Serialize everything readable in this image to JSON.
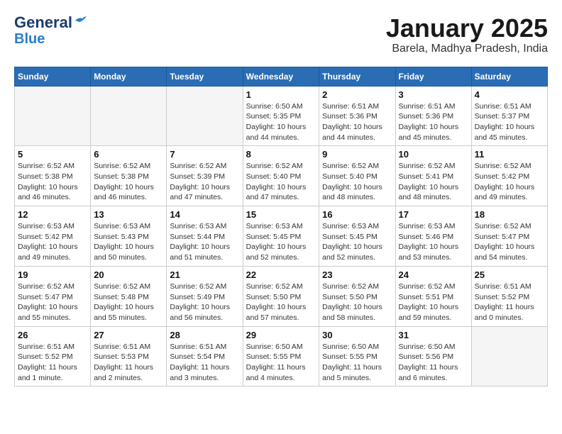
{
  "header": {
    "logo_general": "General",
    "logo_blue": "Blue",
    "month_title": "January 2025",
    "location": "Barela, Madhya Pradesh, India"
  },
  "days_of_week": [
    "Sunday",
    "Monday",
    "Tuesday",
    "Wednesday",
    "Thursday",
    "Friday",
    "Saturday"
  ],
  "weeks": [
    [
      {
        "day": "",
        "info": ""
      },
      {
        "day": "",
        "info": ""
      },
      {
        "day": "",
        "info": ""
      },
      {
        "day": "1",
        "info": "Sunrise: 6:50 AM\nSunset: 5:35 PM\nDaylight: 10 hours\nand 44 minutes."
      },
      {
        "day": "2",
        "info": "Sunrise: 6:51 AM\nSunset: 5:36 PM\nDaylight: 10 hours\nand 44 minutes."
      },
      {
        "day": "3",
        "info": "Sunrise: 6:51 AM\nSunset: 5:36 PM\nDaylight: 10 hours\nand 45 minutes."
      },
      {
        "day": "4",
        "info": "Sunrise: 6:51 AM\nSunset: 5:37 PM\nDaylight: 10 hours\nand 45 minutes."
      }
    ],
    [
      {
        "day": "5",
        "info": "Sunrise: 6:52 AM\nSunset: 5:38 PM\nDaylight: 10 hours\nand 46 minutes."
      },
      {
        "day": "6",
        "info": "Sunrise: 6:52 AM\nSunset: 5:38 PM\nDaylight: 10 hours\nand 46 minutes."
      },
      {
        "day": "7",
        "info": "Sunrise: 6:52 AM\nSunset: 5:39 PM\nDaylight: 10 hours\nand 47 minutes."
      },
      {
        "day": "8",
        "info": "Sunrise: 6:52 AM\nSunset: 5:40 PM\nDaylight: 10 hours\nand 47 minutes."
      },
      {
        "day": "9",
        "info": "Sunrise: 6:52 AM\nSunset: 5:40 PM\nDaylight: 10 hours\nand 48 minutes."
      },
      {
        "day": "10",
        "info": "Sunrise: 6:52 AM\nSunset: 5:41 PM\nDaylight: 10 hours\nand 48 minutes."
      },
      {
        "day": "11",
        "info": "Sunrise: 6:52 AM\nSunset: 5:42 PM\nDaylight: 10 hours\nand 49 minutes."
      }
    ],
    [
      {
        "day": "12",
        "info": "Sunrise: 6:53 AM\nSunset: 5:42 PM\nDaylight: 10 hours\nand 49 minutes."
      },
      {
        "day": "13",
        "info": "Sunrise: 6:53 AM\nSunset: 5:43 PM\nDaylight: 10 hours\nand 50 minutes."
      },
      {
        "day": "14",
        "info": "Sunrise: 6:53 AM\nSunset: 5:44 PM\nDaylight: 10 hours\nand 51 minutes."
      },
      {
        "day": "15",
        "info": "Sunrise: 6:53 AM\nSunset: 5:45 PM\nDaylight: 10 hours\nand 52 minutes."
      },
      {
        "day": "16",
        "info": "Sunrise: 6:53 AM\nSunset: 5:45 PM\nDaylight: 10 hours\nand 52 minutes."
      },
      {
        "day": "17",
        "info": "Sunrise: 6:53 AM\nSunset: 5:46 PM\nDaylight: 10 hours\nand 53 minutes."
      },
      {
        "day": "18",
        "info": "Sunrise: 6:52 AM\nSunset: 5:47 PM\nDaylight: 10 hours\nand 54 minutes."
      }
    ],
    [
      {
        "day": "19",
        "info": "Sunrise: 6:52 AM\nSunset: 5:47 PM\nDaylight: 10 hours\nand 55 minutes."
      },
      {
        "day": "20",
        "info": "Sunrise: 6:52 AM\nSunset: 5:48 PM\nDaylight: 10 hours\nand 55 minutes."
      },
      {
        "day": "21",
        "info": "Sunrise: 6:52 AM\nSunset: 5:49 PM\nDaylight: 10 hours\nand 56 minutes."
      },
      {
        "day": "22",
        "info": "Sunrise: 6:52 AM\nSunset: 5:50 PM\nDaylight: 10 hours\nand 57 minutes."
      },
      {
        "day": "23",
        "info": "Sunrise: 6:52 AM\nSunset: 5:50 PM\nDaylight: 10 hours\nand 58 minutes."
      },
      {
        "day": "24",
        "info": "Sunrise: 6:52 AM\nSunset: 5:51 PM\nDaylight: 10 hours\nand 59 minutes."
      },
      {
        "day": "25",
        "info": "Sunrise: 6:51 AM\nSunset: 5:52 PM\nDaylight: 11 hours\nand 0 minutes."
      }
    ],
    [
      {
        "day": "26",
        "info": "Sunrise: 6:51 AM\nSunset: 5:52 PM\nDaylight: 11 hours\nand 1 minute."
      },
      {
        "day": "27",
        "info": "Sunrise: 6:51 AM\nSunset: 5:53 PM\nDaylight: 11 hours\nand 2 minutes."
      },
      {
        "day": "28",
        "info": "Sunrise: 6:51 AM\nSunset: 5:54 PM\nDaylight: 11 hours\nand 3 minutes."
      },
      {
        "day": "29",
        "info": "Sunrise: 6:50 AM\nSunset: 5:55 PM\nDaylight: 11 hours\nand 4 minutes."
      },
      {
        "day": "30",
        "info": "Sunrise: 6:50 AM\nSunset: 5:55 PM\nDaylight: 11 hours\nand 5 minutes."
      },
      {
        "day": "31",
        "info": "Sunrise: 6:50 AM\nSunset: 5:56 PM\nDaylight: 11 hours\nand 6 minutes."
      },
      {
        "day": "",
        "info": ""
      }
    ]
  ]
}
